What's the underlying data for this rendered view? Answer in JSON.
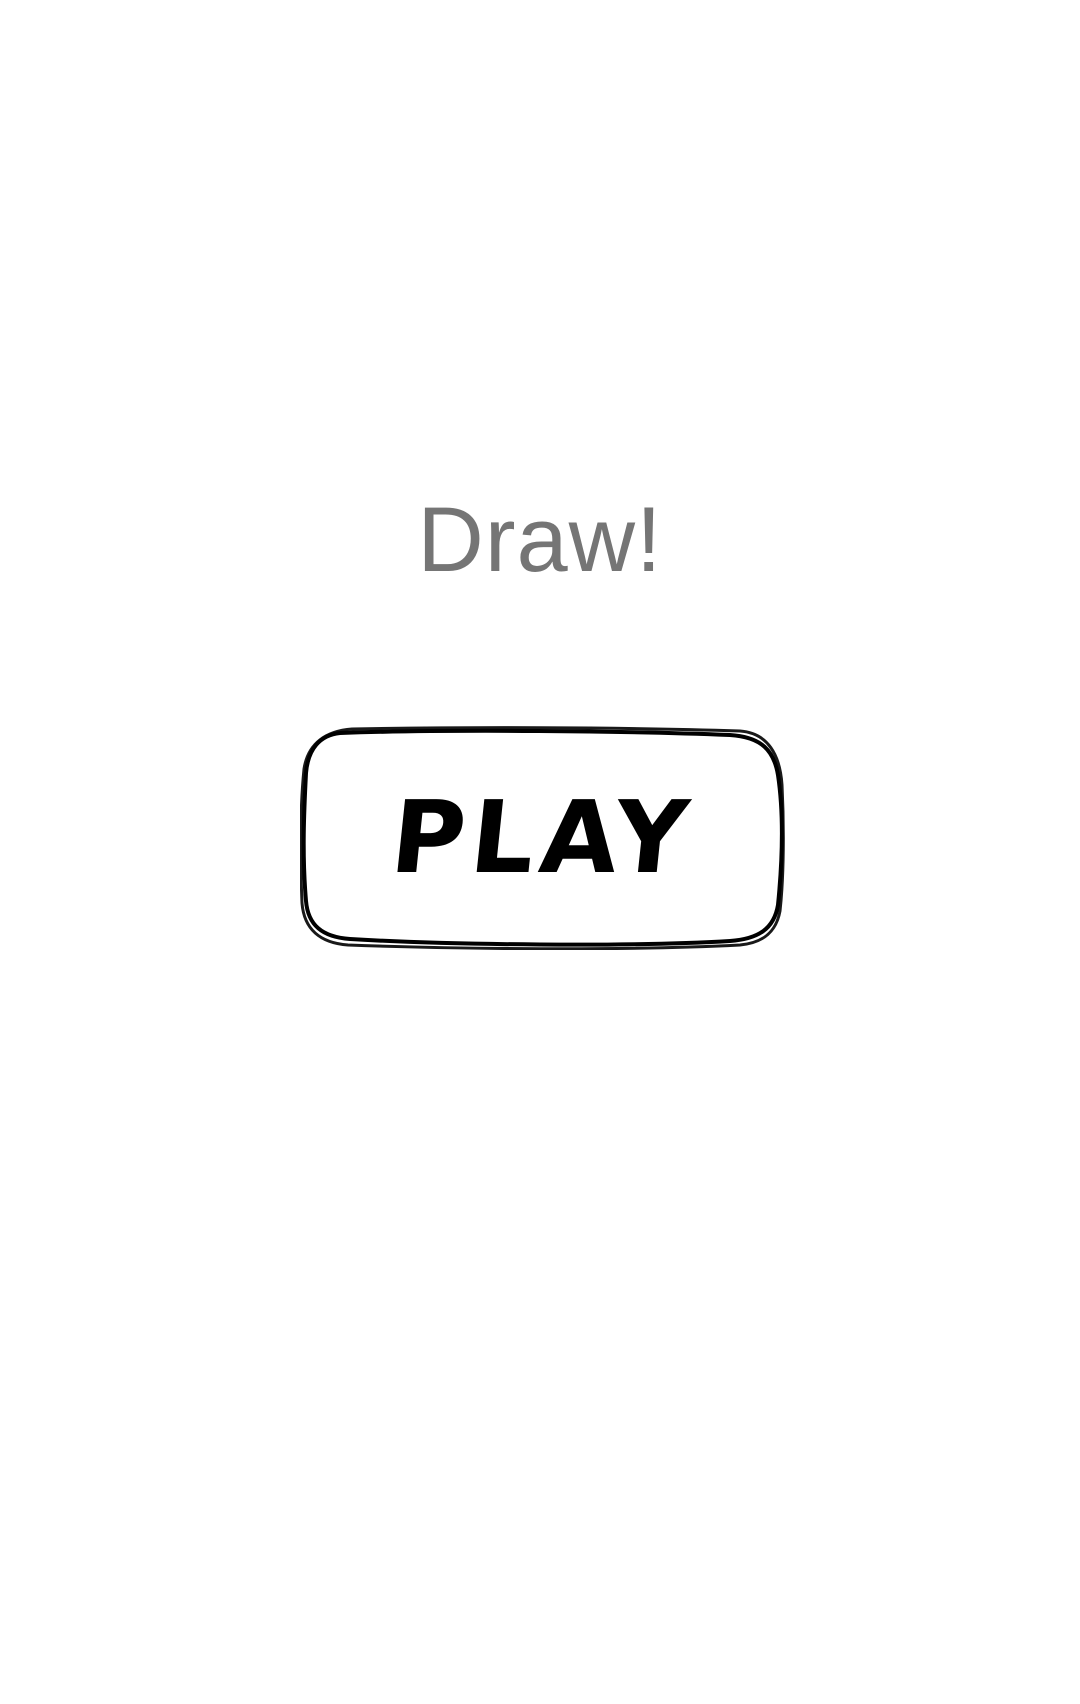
{
  "app": {
    "title": "Draw!"
  },
  "main": {
    "play_label": "PLAY"
  },
  "colors": {
    "background": "#ffffff",
    "title": "#757575",
    "ink": "#000000"
  }
}
